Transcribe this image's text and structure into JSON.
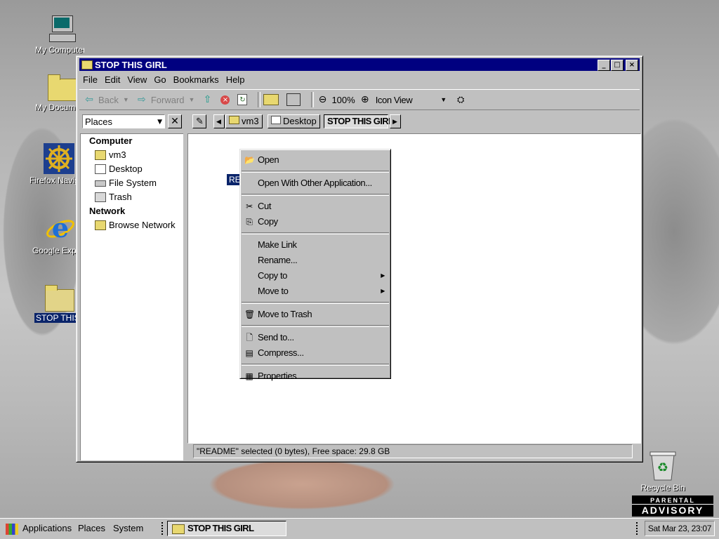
{
  "desktop": {
    "icons": [
      {
        "label": "My Computer",
        "icon": "computer-icon"
      },
      {
        "label": "My Documents",
        "icon": "documents-folder-icon"
      },
      {
        "label": "Firefox Navigator",
        "icon": "ship-wheel-icon"
      },
      {
        "label": "Google Explorer",
        "icon": "ie-logo-icon"
      },
      {
        "label": "STOP THIS GIRL",
        "icon": "folder-icon"
      },
      {
        "label": "Recycle Bin",
        "icon": "recycle-bin-icon"
      }
    ],
    "advisory": {
      "line1": "PARENTAL",
      "line2": "ADVISORY"
    }
  },
  "window": {
    "title": "STOP THIS GIRL",
    "controls": {
      "minimize": "_",
      "maximize": "□",
      "close": "×"
    },
    "menu": [
      "File",
      "Edit",
      "View",
      "Go",
      "Bookmarks",
      "Help"
    ],
    "toolbar": {
      "back": "Back",
      "forward": "Forward",
      "zoom": "100%",
      "view_mode": "Icon View"
    },
    "places_select": "Places",
    "path": [
      "vm3",
      "Desktop",
      "STOP THIS GIRL"
    ],
    "sidebar": {
      "computer_header": "Computer",
      "computer_items": [
        "vm3",
        "Desktop",
        "File System",
        "Trash"
      ],
      "network_header": "Network",
      "network_items": [
        "Browse Network"
      ]
    },
    "file_label": "RE",
    "status": "\"README\" selected (0 bytes), Free space: 29.8 GB"
  },
  "context_menu": {
    "open": "Open",
    "open_with": "Open With Other Application...",
    "cut": "Cut",
    "copy": "Copy",
    "make_link": "Make Link",
    "rename": "Rename...",
    "copy_to": "Copy to",
    "move_to": "Move to",
    "move_to_trash": "Move to Trash",
    "send_to": "Send to...",
    "compress": "Compress...",
    "properties": "Properties"
  },
  "taskbar": {
    "applications": "Applications",
    "places": "Places",
    "system": "System",
    "task": "STOP THIS GIRL",
    "clock": "Sat Mar 23, 23:07"
  }
}
